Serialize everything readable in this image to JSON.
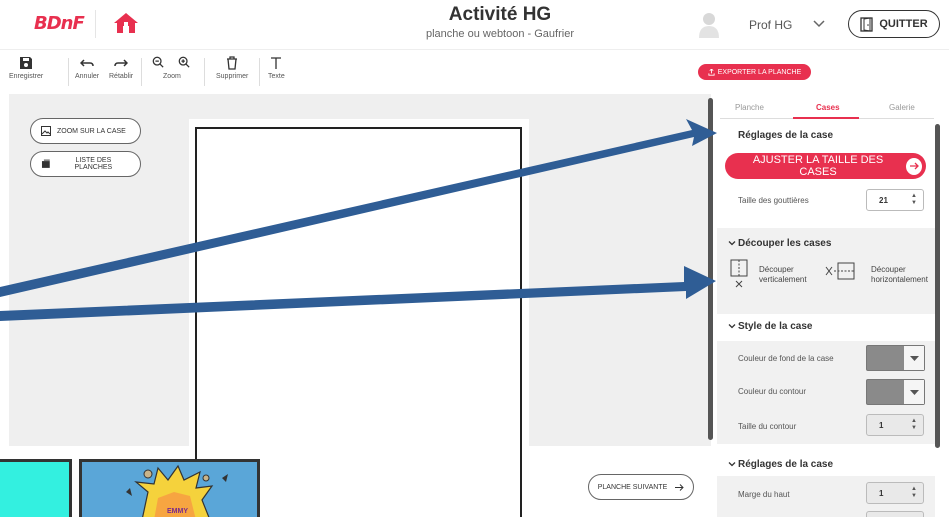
{
  "header": {
    "logo": "BDnF",
    "title": "Activité HG",
    "subtitle": "planche ou webtoon - Gaufrier",
    "user_name": "Prof HG",
    "quit_label": "QUITTER"
  },
  "toolbar": {
    "save": "Enregistrer",
    "undo": "Annuler",
    "redo": "Rétablir",
    "zoom": "Zoom",
    "delete": "Supprimer",
    "text": "Texte",
    "export": "EXPORTER LA PLANCHE"
  },
  "canvas": {
    "zoom_case": "ZOOM SUR LA CASE",
    "list_pages": "LISTE DES PLANCHES",
    "next_page": "PLANCHE SUIVANTE",
    "thumb_text": "EMMY"
  },
  "panel": {
    "tabs": [
      "Planche",
      "Cases",
      "Galerie"
    ],
    "active_tab": "Cases",
    "reglages_title": "Réglages de la case",
    "adjust_btn": "AJUSTER LA TAILLE DES CASES",
    "gutter_label": "Taille des gouttières",
    "gutter_value": "21",
    "cut_title": "Découper les cases",
    "cut_vertical": "Découper\nverticalement",
    "cut_horizontal": "Découper\nhorizontalement",
    "style_title": "Style de la case",
    "bg_color_label": "Couleur de fond de la case",
    "border_color_label": "Couleur du contour",
    "border_size_label": "Taille du contour",
    "border_size_value": "1",
    "reglages2_title": "Réglages de la case",
    "margin_top_label": "Marge du haut",
    "margin_top_value": "1"
  },
  "colors": {
    "accent": "#e8304f",
    "arrow": "#2f5d95",
    "swatch": "#8a8a8a"
  }
}
